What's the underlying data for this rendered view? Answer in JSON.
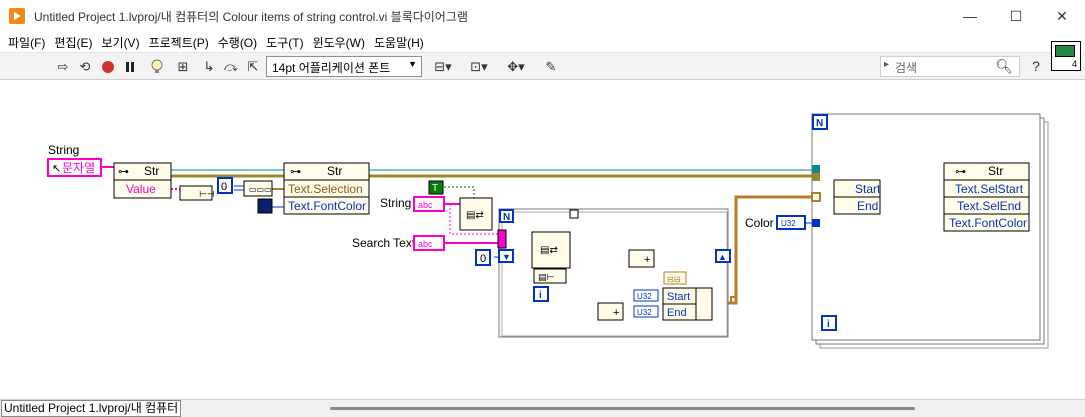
{
  "window": {
    "title": "Untitled Project 1.lvproj/내 컴퓨터의 Colour items of string control.vi 블록다이어그램",
    "minimize_glyph": "—",
    "maximize_glyph": "☐",
    "close_glyph": "✕"
  },
  "menu": {
    "items": [
      "파일(F)",
      "편집(E)",
      "보기(V)",
      "프로젝트(P)",
      "수행(O)",
      "도구(T)",
      "윈도우(W)",
      "도움말(H)"
    ]
  },
  "toolbar": {
    "font_select_value": "14pt 어플리케이션 폰트",
    "search_placeholder": "검색",
    "connector_count": "4"
  },
  "diagram": {
    "string_label": "String",
    "string_terminal": "문자열",
    "value_prop": "Value",
    "str_node": "Str",
    "text_selection_prop": "Text.Selection",
    "text_fontcolor_prop": "Text.FontColor",
    "const_zero": "0",
    "const_zero_loop": "0",
    "bool_true": "T",
    "string_ctrl_label": "String",
    "search_text_label": "Search Text",
    "abc_terminal": "abc",
    "n_terminal": "N",
    "i_terminal": "i",
    "u32_type": "U32",
    "start_label": "Start",
    "end_label": "End",
    "color_label": "Color",
    "sel_start_prop": "Text.SelStart",
    "sel_end_prop": "Text.SelEnd",
    "fontcolor_prop_2": "Text.FontColor",
    "plus_glyph": "+",
    "arrow_glyph": "⊷"
  },
  "statusbar": {
    "path": "Untitled Project 1.lvproj/내 컴퓨터"
  },
  "colors": {
    "string_wire": "#ff00cc",
    "numeric_wire": "#0033cc",
    "bool_wire": "#006600",
    "cluster_wire": "#b97a2a",
    "refnum_wire": "#0b8a8a",
    "property_bg": "#fffdea"
  }
}
